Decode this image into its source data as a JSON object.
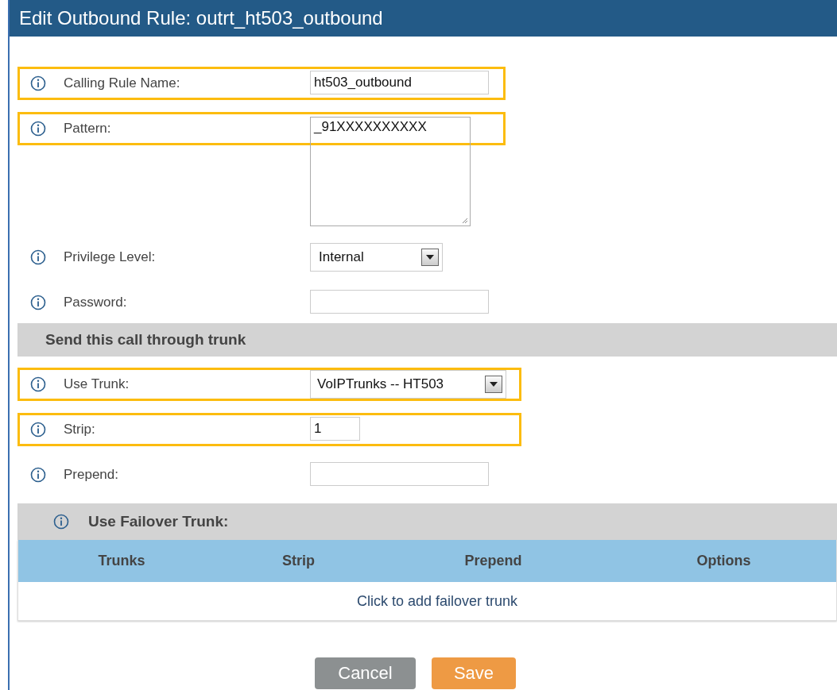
{
  "window": {
    "title": "Edit Outbound Rule: outrt_ht503_outbound"
  },
  "fields": [
    {
      "kind": "text",
      "label": "Calling Rule Name:",
      "value": "ht503_outbound",
      "highlighted": true
    },
    {
      "kind": "textarea",
      "label": "Pattern:",
      "value": "_91XXXXXXXXXX",
      "highlighted": true
    },
    {
      "kind": "select",
      "label": "Privilege Level:",
      "value": "Internal",
      "highlighted": false
    },
    {
      "kind": "text",
      "label": "Password:",
      "highlighted": false
    }
  ],
  "trunk_section": {
    "title": "Send this call through trunk"
  },
  "trunk_fields": [
    {
      "kind": "select",
      "label": "Use Trunk:",
      "value": "VoIPTrunks -- HT503",
      "highlighted": true
    },
    {
      "kind": "short",
      "label": "Strip:",
      "value": "1",
      "highlighted": true
    },
    {
      "kind": "text",
      "label": "Prepend:",
      "highlighted": false
    }
  ],
  "failover": {
    "title": "Use Failover Trunk:",
    "columns": [
      "Trunks",
      "Strip",
      "Prepend",
      "Options"
    ],
    "add_link": "Click to add failover trunk"
  },
  "buttons": [
    {
      "kind": "cancel",
      "label": "Cancel"
    },
    {
      "kind": "save",
      "label": "Save"
    }
  ]
}
